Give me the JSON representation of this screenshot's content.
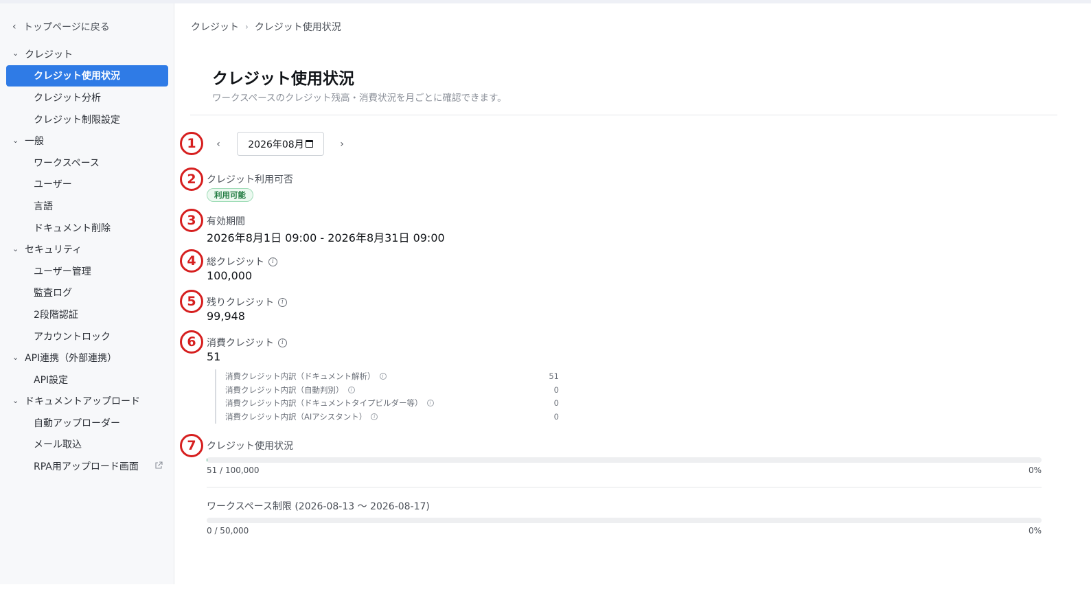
{
  "sidebar": {
    "back_label": "トップページに戻る",
    "groups": [
      {
        "label": "クレジット",
        "items": [
          "クレジット使用状況",
          "クレジット分析",
          "クレジット制限設定"
        ]
      },
      {
        "label": "一般",
        "items": [
          "ワークスペース",
          "ユーザー",
          "言語",
          "ドキュメント削除"
        ]
      },
      {
        "label": "セキュリティ",
        "items": [
          "ユーザー管理",
          "監査ログ",
          "2段階認証",
          "アカウントロック"
        ]
      },
      {
        "label": "API連携（外部連携）",
        "items": [
          "API設定"
        ]
      },
      {
        "label": "ドキュメントアップロード",
        "items": [
          "自動アップローダー",
          "メール取込",
          "RPA用アップロード画面"
        ]
      }
    ],
    "active_item": "クレジット使用状況"
  },
  "breadcrumb": [
    "クレジット",
    "クレジット使用状況"
  ],
  "page": {
    "title": "クレジット使用状況",
    "subtitle": "ワークスペースのクレジット残高・消費状況を月ごとに確認できます。"
  },
  "markers": [
    "1",
    "2",
    "3",
    "4",
    "5",
    "6",
    "7"
  ],
  "month_picker": {
    "value": "2026年08月",
    "prev_icon": "chevron-left-icon",
    "next_icon": "chevron-right-icon"
  },
  "availability": {
    "label": "クレジット利用可否",
    "badge": "利用可能",
    "badge_color": "#1f7a3f"
  },
  "period": {
    "label": "有効期間",
    "value": "2026年8月1日 09:00 - 2026年8月31日 09:00"
  },
  "total_credits": {
    "label": "総クレジット",
    "value": "100,000"
  },
  "remaining_credits": {
    "label": "残りクレジット",
    "value": "99,948"
  },
  "consumed_credits": {
    "label": "消費クレジット",
    "value": "51",
    "breakdown": [
      {
        "label": "消費クレジット内訳（ドキュメント解析）",
        "value": "51"
      },
      {
        "label": "消費クレジット内訳（自動判別）",
        "value": "0"
      },
      {
        "label": "消費クレジット内訳（ドキュメントタイプビルダー等）",
        "value": "0"
      },
      {
        "label": "消費クレジット内訳（AIアシスタント）",
        "value": "0"
      }
    ]
  },
  "usage": {
    "label": "クレジット使用状況",
    "used_text": "51 / 100,000",
    "percent_text": "0%",
    "fraction": 0.00051,
    "fill_color": "#22a06b"
  },
  "workspace_limit": {
    "label": "ワークスペース制限 (2026-08-13 〜 2026-08-17)",
    "used_text": "0 / 50,000",
    "percent_text": "0%",
    "fraction": 0
  },
  "accent_color": "#2f7be6"
}
